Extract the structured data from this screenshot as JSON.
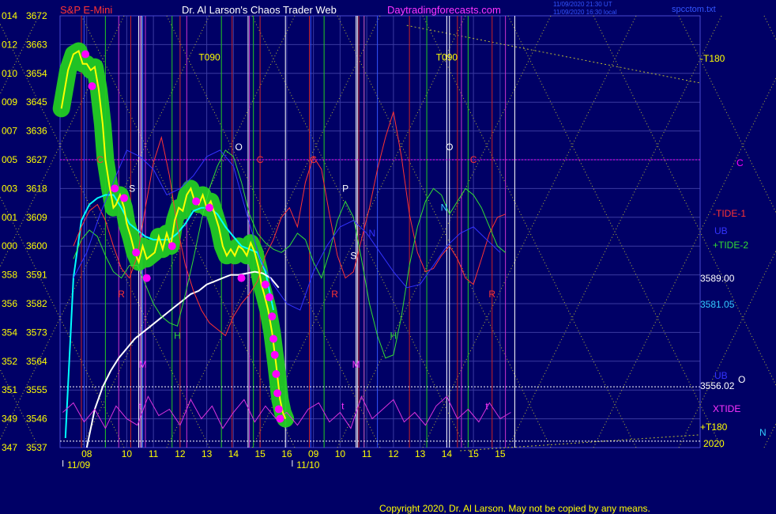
{
  "header": {
    "instrument": "S&P E-Mini",
    "title": "Dr. Al Larson's Chaos Trader Web",
    "site": "Daytradingforecasts.com",
    "timestamp_1": "11/09/2020 21:30 UT",
    "timestamp_2": "11/09/2020 16:30 local",
    "file": "spcctom.txt"
  },
  "footer": {
    "copyright": "Copyright 2020, Dr. Al Larson. May not be copied by any means."
  },
  "colors": {
    "background": "#000066",
    "grid": "#3a3aa0",
    "price": "#ffff00",
    "highlight": "#22cc22",
    "dots": "#ff00ff",
    "ma_fast": "#00ffff",
    "ma_slow": "#ffffff",
    "tide1": "#ff3333",
    "tide2": "#33dd33",
    "ub": "#3333ff",
    "xtide": "#dd33dd"
  },
  "chart_data": {
    "type": "line",
    "ylim": [
      3537,
      3672
    ],
    "y_ticks": [
      {
        "left": "014",
        "right": "3672",
        "value": 3672
      },
      {
        "left": "012",
        "right": "3663",
        "value": 3663
      },
      {
        "left": "010",
        "right": "3654",
        "value": 3654
      },
      {
        "left": "009",
        "right": "3645",
        "value": 3645
      },
      {
        "left": "007",
        "right": "3636",
        "value": 3636
      },
      {
        "left": "005",
        "right": "3627",
        "value": 3627
      },
      {
        "left": "003",
        "right": "3618",
        "value": 3618
      },
      {
        "left": "001",
        "right": "3609",
        "value": 3609
      },
      {
        "left": "000",
        "right": "3600",
        "value": 3600
      },
      {
        "left": "358",
        "right": "3591",
        "value": 3591
      },
      {
        "left": "356",
        "right": "3582",
        "value": 3582
      },
      {
        "left": "354",
        "right": "3573",
        "value": 3573
      },
      {
        "left": "352",
        "right": "3564",
        "value": 3564
      },
      {
        "left": "351",
        "right": "3555",
        "value": 3555
      },
      {
        "left": "349",
        "right": "3546",
        "value": 3546
      },
      {
        "left": "347",
        "right": "3537",
        "value": 3537
      }
    ],
    "xlim": [
      7.5,
      31.5
    ],
    "x_ticks": [
      {
        "label": "08",
        "x": 8.5
      },
      {
        "label": "10",
        "x": 10
      },
      {
        "label": "11",
        "x": 11
      },
      {
        "label": "12",
        "x": 12
      },
      {
        "label": "13",
        "x": 13
      },
      {
        "label": "14",
        "x": 14
      },
      {
        "label": "15",
        "x": 15
      },
      {
        "label": "16",
        "x": 16
      },
      {
        "label": "09",
        "x": 17
      },
      {
        "label": "10",
        "x": 18
      },
      {
        "label": "11",
        "x": 19
      },
      {
        "label": "12",
        "x": 20
      },
      {
        "label": "13",
        "x": 21
      },
      {
        "label": "14",
        "x": 22
      },
      {
        "label": "15",
        "x": 23
      },
      {
        "label": "15",
        "x": 24
      }
    ],
    "date_labels": [
      {
        "label": "11/09",
        "x": 8.2
      },
      {
        "label": "11/10",
        "x": 16.8
      }
    ],
    "right_labels": [
      {
        "text": "-T180",
        "color": "#ffff00"
      },
      {
        "text": "C",
        "color": "#ff00ff"
      },
      {
        "text": "-TIDE-1",
        "color": "#ff3333"
      },
      {
        "text": "UB",
        "color": "#3333ff"
      },
      {
        "text": "+TIDE-2",
        "color": "#33dd33"
      },
      {
        "text": "3589.00",
        "color": "#ffffff"
      },
      {
        "text": "3581.05",
        "color": "#33ccff"
      },
      {
        "text": "UB",
        "color": "#3333ff"
      },
      {
        "text": "O",
        "color": "#ffffff"
      },
      {
        "text": "3556.02",
        "color": "#ffffff"
      },
      {
        "text": "XTIDE",
        "color": "#ff33ff"
      },
      {
        "text": "+T180",
        "color": "#ffff00"
      },
      {
        "text": "N",
        "color": "#33ccff"
      },
      {
        "text": "2020",
        "color": "#ffff00"
      }
    ],
    "reference_levels": [
      {
        "value": 3627,
        "color": "#ff00ff"
      },
      {
        "value": 3556,
        "color": "#ffffff"
      },
      {
        "value": 3539,
        "color": "#ffffff"
      }
    ],
    "annotations": [
      {
        "text": "T090",
        "x": 13.1,
        "y": 3658,
        "color": "#ffff00"
      },
      {
        "text": "T090",
        "x": 22.0,
        "y": 3658,
        "color": "#ffff00"
      },
      {
        "text": "O",
        "x": 14.2,
        "y": 3630,
        "color": "#ffffff"
      },
      {
        "text": "O",
        "x": 22.1,
        "y": 3630,
        "color": "#ffffff"
      },
      {
        "text": "C",
        "x": 9.0,
        "y": 3626,
        "color": "#ff3333"
      },
      {
        "text": "C",
        "x": 15.0,
        "y": 3626,
        "color": "#ff3333"
      },
      {
        "text": "C",
        "x": 17.0,
        "y": 3626,
        "color": "#ff3333"
      },
      {
        "text": "C",
        "x": 23.0,
        "y": 3626,
        "color": "#ff3333"
      },
      {
        "text": "S",
        "x": 10.2,
        "y": 3617,
        "color": "#ffffff"
      },
      {
        "text": "S",
        "x": 18.5,
        "y": 3596,
        "color": "#ffffff"
      },
      {
        "text": "P",
        "x": 18.2,
        "y": 3617,
        "color": "#ffffff"
      },
      {
        "text": "N",
        "x": 21.9,
        "y": 3611,
        "color": "#33ccff"
      },
      {
        "text": "N",
        "x": 19.2,
        "y": 3603,
        "color": "#3333ff"
      },
      {
        "text": "R",
        "x": 9.8,
        "y": 3584,
        "color": "#ff3333"
      },
      {
        "text": "R",
        "x": 17.8,
        "y": 3584,
        "color": "#ff3333"
      },
      {
        "text": "R",
        "x": 23.7,
        "y": 3584,
        "color": "#ff3333"
      },
      {
        "text": "H",
        "x": 11.9,
        "y": 3571,
        "color": "#33dd33"
      },
      {
        "text": "H",
        "x": 20.0,
        "y": 3571,
        "color": "#33dd33"
      },
      {
        "text": "M",
        "x": 10.6,
        "y": 3562,
        "color": "#ff33ff"
      },
      {
        "text": "M",
        "x": 18.6,
        "y": 3562,
        "color": "#ff33ff"
      },
      {
        "text": "t",
        "x": 10.5,
        "y": 3549,
        "color": "#ff33ff"
      },
      {
        "text": "t",
        "x": 18.1,
        "y": 3549,
        "color": "#ff33ff"
      },
      {
        "text": "t",
        "x": 23.5,
        "y": 3549,
        "color": "#ff33ff"
      }
    ],
    "vlines_red": [
      8.3,
      10.15,
      12.0,
      13.95,
      15.0,
      16.85,
      18.7,
      20.6,
      22.4,
      23.7
    ],
    "vlines_green": [
      9.2,
      11.7,
      13.55,
      14.75,
      17.4,
      18.9,
      21.25,
      22.8
    ],
    "vlines_blue": [
      8.4,
      10.6,
      16.9,
      19.4
    ],
    "vlines_white": [
      10.45,
      10.55,
      14.55,
      15.95,
      18.6,
      18.65,
      22.0,
      22.1,
      24.55
    ],
    "vlines_magenta": [
      9.7,
      10.5,
      10.7,
      12.25,
      14.6,
      18.9,
      22.55,
      24.2
    ],
    "series": [
      {
        "key": "price",
        "color": "#ffff00",
        "x": [
          7.55,
          7.8,
          8.0,
          8.2,
          8.35,
          8.5,
          8.65,
          8.8,
          8.95,
          9.1,
          9.2,
          9.35,
          9.5,
          9.6,
          9.75,
          9.9,
          10.0,
          10.15,
          10.3,
          10.45,
          10.6,
          10.75,
          10.9,
          11.05,
          11.2,
          11.35,
          11.5,
          11.65,
          11.8,
          11.95,
          12.1,
          12.25,
          12.4,
          12.55,
          12.7,
          12.85,
          13.0,
          13.15,
          13.3,
          13.45,
          13.6,
          13.75,
          13.9,
          14.05,
          14.2,
          14.35,
          14.5,
          14.65,
          14.8,
          14.95,
          15.05,
          15.15,
          15.3,
          15.45,
          15.6,
          15.75,
          15.85,
          15.95
        ],
        "values": [
          3643,
          3655,
          3660,
          3661,
          3657,
          3657,
          3655,
          3656,
          3649,
          3638,
          3627,
          3619,
          3612,
          3613,
          3616,
          3612,
          3607,
          3603,
          3598,
          3595,
          3600,
          3596,
          3597,
          3598,
          3603,
          3599,
          3604,
          3600,
          3608,
          3612,
          3611,
          3616,
          3618,
          3614,
          3613,
          3616,
          3612,
          3614,
          3610,
          3606,
          3600,
          3597,
          3599,
          3597,
          3600,
          3599,
          3597,
          3601,
          3598,
          3593,
          3588,
          3585,
          3580,
          3573,
          3563,
          3552,
          3548,
          3546
        ]
      },
      {
        "key": "ma_fast",
        "color": "#00ffff",
        "x": [
          7.7,
          8.0,
          8.3,
          8.6,
          8.9,
          9.2,
          9.5,
          9.8,
          10.1,
          10.4,
          10.7,
          11.0,
          11.3,
          11.6,
          11.9,
          12.2,
          12.5,
          12.8,
          13.1,
          13.4,
          13.7,
          14.0,
          14.3,
          14.6,
          14.9,
          15.2,
          15.5
        ],
        "values": [
          3540,
          3590,
          3608,
          3613,
          3615,
          3616,
          3616,
          3612,
          3607,
          3605,
          3603,
          3602,
          3602,
          3602,
          3604,
          3607,
          3611,
          3612,
          3612,
          3610,
          3606,
          3603,
          3600,
          3599,
          3598,
          3592,
          3580
        ]
      },
      {
        "key": "ma_slow",
        "color": "#ffffff",
        "x": [
          8.5,
          8.8,
          9.1,
          9.4,
          9.7,
          10.0,
          10.3,
          10.6,
          10.9,
          11.2,
          11.5,
          11.8,
          12.1,
          12.4,
          12.7,
          13.0,
          13.3,
          13.6,
          13.9,
          14.2,
          14.5,
          14.8,
          15.1,
          15.4,
          15.7
        ],
        "values": [
          3537,
          3549,
          3556,
          3561,
          3565,
          3568,
          3571,
          3573,
          3575,
          3577,
          3579,
          3581,
          3583,
          3585,
          3586,
          3588,
          3589,
          3590,
          3591,
          3591,
          3591.5,
          3592,
          3591.5,
          3590,
          3587
        ]
      },
      {
        "key": "tide1",
        "color": "#ff3333",
        "x": [
          8.0,
          8.3,
          8.6,
          8.9,
          9.2,
          9.5,
          9.8,
          10.1,
          10.4,
          10.7,
          11.0,
          11.3,
          11.6,
          11.9,
          12.2,
          12.5,
          12.8,
          13.1,
          13.4,
          13.7,
          14.0,
          14.3,
          14.6,
          14.9,
          15.2,
          15.5,
          15.8,
          16.1,
          16.4,
          16.7,
          17.0,
          17.3,
          17.6,
          17.9,
          18.2,
          18.5,
          18.8,
          19.1,
          19.4,
          19.7,
          20.0,
          20.3,
          20.6,
          20.9,
          21.2,
          21.5,
          21.8,
          22.1,
          22.4,
          22.7,
          23.0,
          23.3,
          23.6,
          23.9,
          24.2
        ],
        "values": [
          3600,
          3606,
          3611,
          3613,
          3608,
          3600,
          3593,
          3590,
          3597,
          3612,
          3626,
          3634,
          3622,
          3606,
          3594,
          3586,
          3580,
          3576,
          3574,
          3572,
          3578,
          3582,
          3585,
          3589,
          3597,
          3602,
          3609,
          3612,
          3606,
          3620,
          3628,
          3624,
          3610,
          3597,
          3590,
          3592,
          3602,
          3612,
          3624,
          3634,
          3642,
          3628,
          3610,
          3598,
          3592,
          3593,
          3597,
          3600,
          3596,
          3590,
          3588,
          3596,
          3604,
          3609,
          3610
        ]
      },
      {
        "key": "tide2",
        "color": "#33dd33",
        "x": [
          8.0,
          8.3,
          8.6,
          8.9,
          9.2,
          9.5,
          9.8,
          10.1,
          10.4,
          10.7,
          11.0,
          11.3,
          11.6,
          11.9,
          12.2,
          12.5,
          12.8,
          13.1,
          13.4,
          13.7,
          14.0,
          14.3,
          14.6,
          14.9,
          15.2,
          15.5,
          15.8,
          16.1,
          16.4,
          16.7,
          17.0,
          17.3,
          17.6,
          17.9,
          18.2,
          18.5,
          18.8,
          19.1,
          19.4,
          19.7,
          20.0,
          20.3,
          20.6,
          20.9,
          21.2,
          21.5,
          21.8,
          22.1,
          22.4,
          22.7,
          23.0,
          23.3,
          23.6,
          23.9,
          24.2
        ],
        "values": [
          3596,
          3602,
          3605,
          3603,
          3597,
          3592,
          3590,
          3594,
          3594,
          3588,
          3582,
          3578,
          3576,
          3575,
          3585,
          3596,
          3608,
          3618,
          3625,
          3630,
          3628,
          3620,
          3610,
          3604,
          3601,
          3599,
          3598,
          3600,
          3604,
          3602,
          3595,
          3590,
          3598,
          3608,
          3614,
          3609,
          3596,
          3582,
          3572,
          3565,
          3566,
          3578,
          3594,
          3606,
          3614,
          3618,
          3616,
          3610,
          3614,
          3618,
          3616,
          3612,
          3606,
          3600,
          3598
        ]
      },
      {
        "key": "ub",
        "color": "#3333ff",
        "x": [
          8.0,
          8.5,
          9.0,
          9.5,
          10.0,
          10.5,
          11.0,
          11.5,
          12.0,
          12.5,
          13.0,
          13.5,
          14.0,
          14.5,
          15.0,
          15.5,
          16.0,
          16.5,
          17.0,
          17.5,
          18.0,
          18.5,
          19.0,
          19.5,
          20.0,
          20.5,
          21.0,
          21.5,
          22.0,
          22.5,
          23.0,
          23.5,
          24.0
        ],
        "values": [
          3590,
          3598,
          3610,
          3620,
          3630,
          3628,
          3624,
          3616,
          3618,
          3622,
          3628,
          3630,
          3625,
          3610,
          3596,
          3588,
          3582,
          3580,
          3592,
          3600,
          3606,
          3608,
          3604,
          3598,
          3592,
          3587,
          3588,
          3594,
          3600,
          3604,
          3606,
          3602,
          3598
        ]
      },
      {
        "key": "xtide",
        "color": "#dd33dd",
        "x": [
          7.6,
          8.0,
          8.4,
          8.8,
          9.2,
          9.6,
          10.0,
          10.4,
          10.8,
          11.2,
          11.6,
          12.0,
          12.4,
          12.8,
          13.2,
          13.6,
          14.0,
          14.4,
          14.8,
          15.2,
          15.6,
          16.0,
          16.4,
          16.8,
          17.2,
          17.6,
          18.0,
          18.4,
          18.8,
          19.2,
          19.6,
          20.0,
          20.4,
          20.8,
          21.2,
          21.6,
          22.0,
          22.4,
          22.8,
          23.2,
          23.6,
          24.0,
          24.4
        ],
        "values": [
          3548,
          3551,
          3545,
          3549,
          3543,
          3550,
          3546,
          3544,
          3553,
          3547,
          3549,
          3544,
          3552,
          3546,
          3550,
          3543,
          3548,
          3552,
          3545,
          3550,
          3546,
          3548,
          3544,
          3549,
          3551,
          3545,
          3548,
          3543,
          3553,
          3546,
          3549,
          3552,
          3545,
          3548,
          3544,
          3550,
          3553,
          3546,
          3549,
          3545,
          3551,
          3546,
          3548
        ]
      }
    ],
    "pivot_dots": [
      {
        "x": 9.55,
        "y": 3618
      },
      {
        "x": 9.9,
        "y": 3615
      },
      {
        "x": 10.35,
        "y": 3598
      },
      {
        "x": 10.75,
        "y": 3590
      },
      {
        "x": 11.7,
        "y": 3600
      },
      {
        "x": 12.6,
        "y": 3614
      },
      {
        "x": 13.1,
        "y": 3612
      },
      {
        "x": 14.3,
        "y": 3590
      },
      {
        "x": 15.2,
        "y": 3588
      },
      {
        "x": 15.35,
        "y": 3584
      },
      {
        "x": 15.45,
        "y": 3578
      },
      {
        "x": 15.5,
        "y": 3571
      },
      {
        "x": 15.55,
        "y": 3566
      },
      {
        "x": 15.6,
        "y": 3560
      },
      {
        "x": 15.65,
        "y": 3554
      },
      {
        "x": 15.7,
        "y": 3549
      },
      {
        "x": 15.75,
        "y": 3546
      },
      {
        "x": 8.7,
        "y": 3650
      },
      {
        "x": 8.45,
        "y": 3660
      }
    ]
  }
}
